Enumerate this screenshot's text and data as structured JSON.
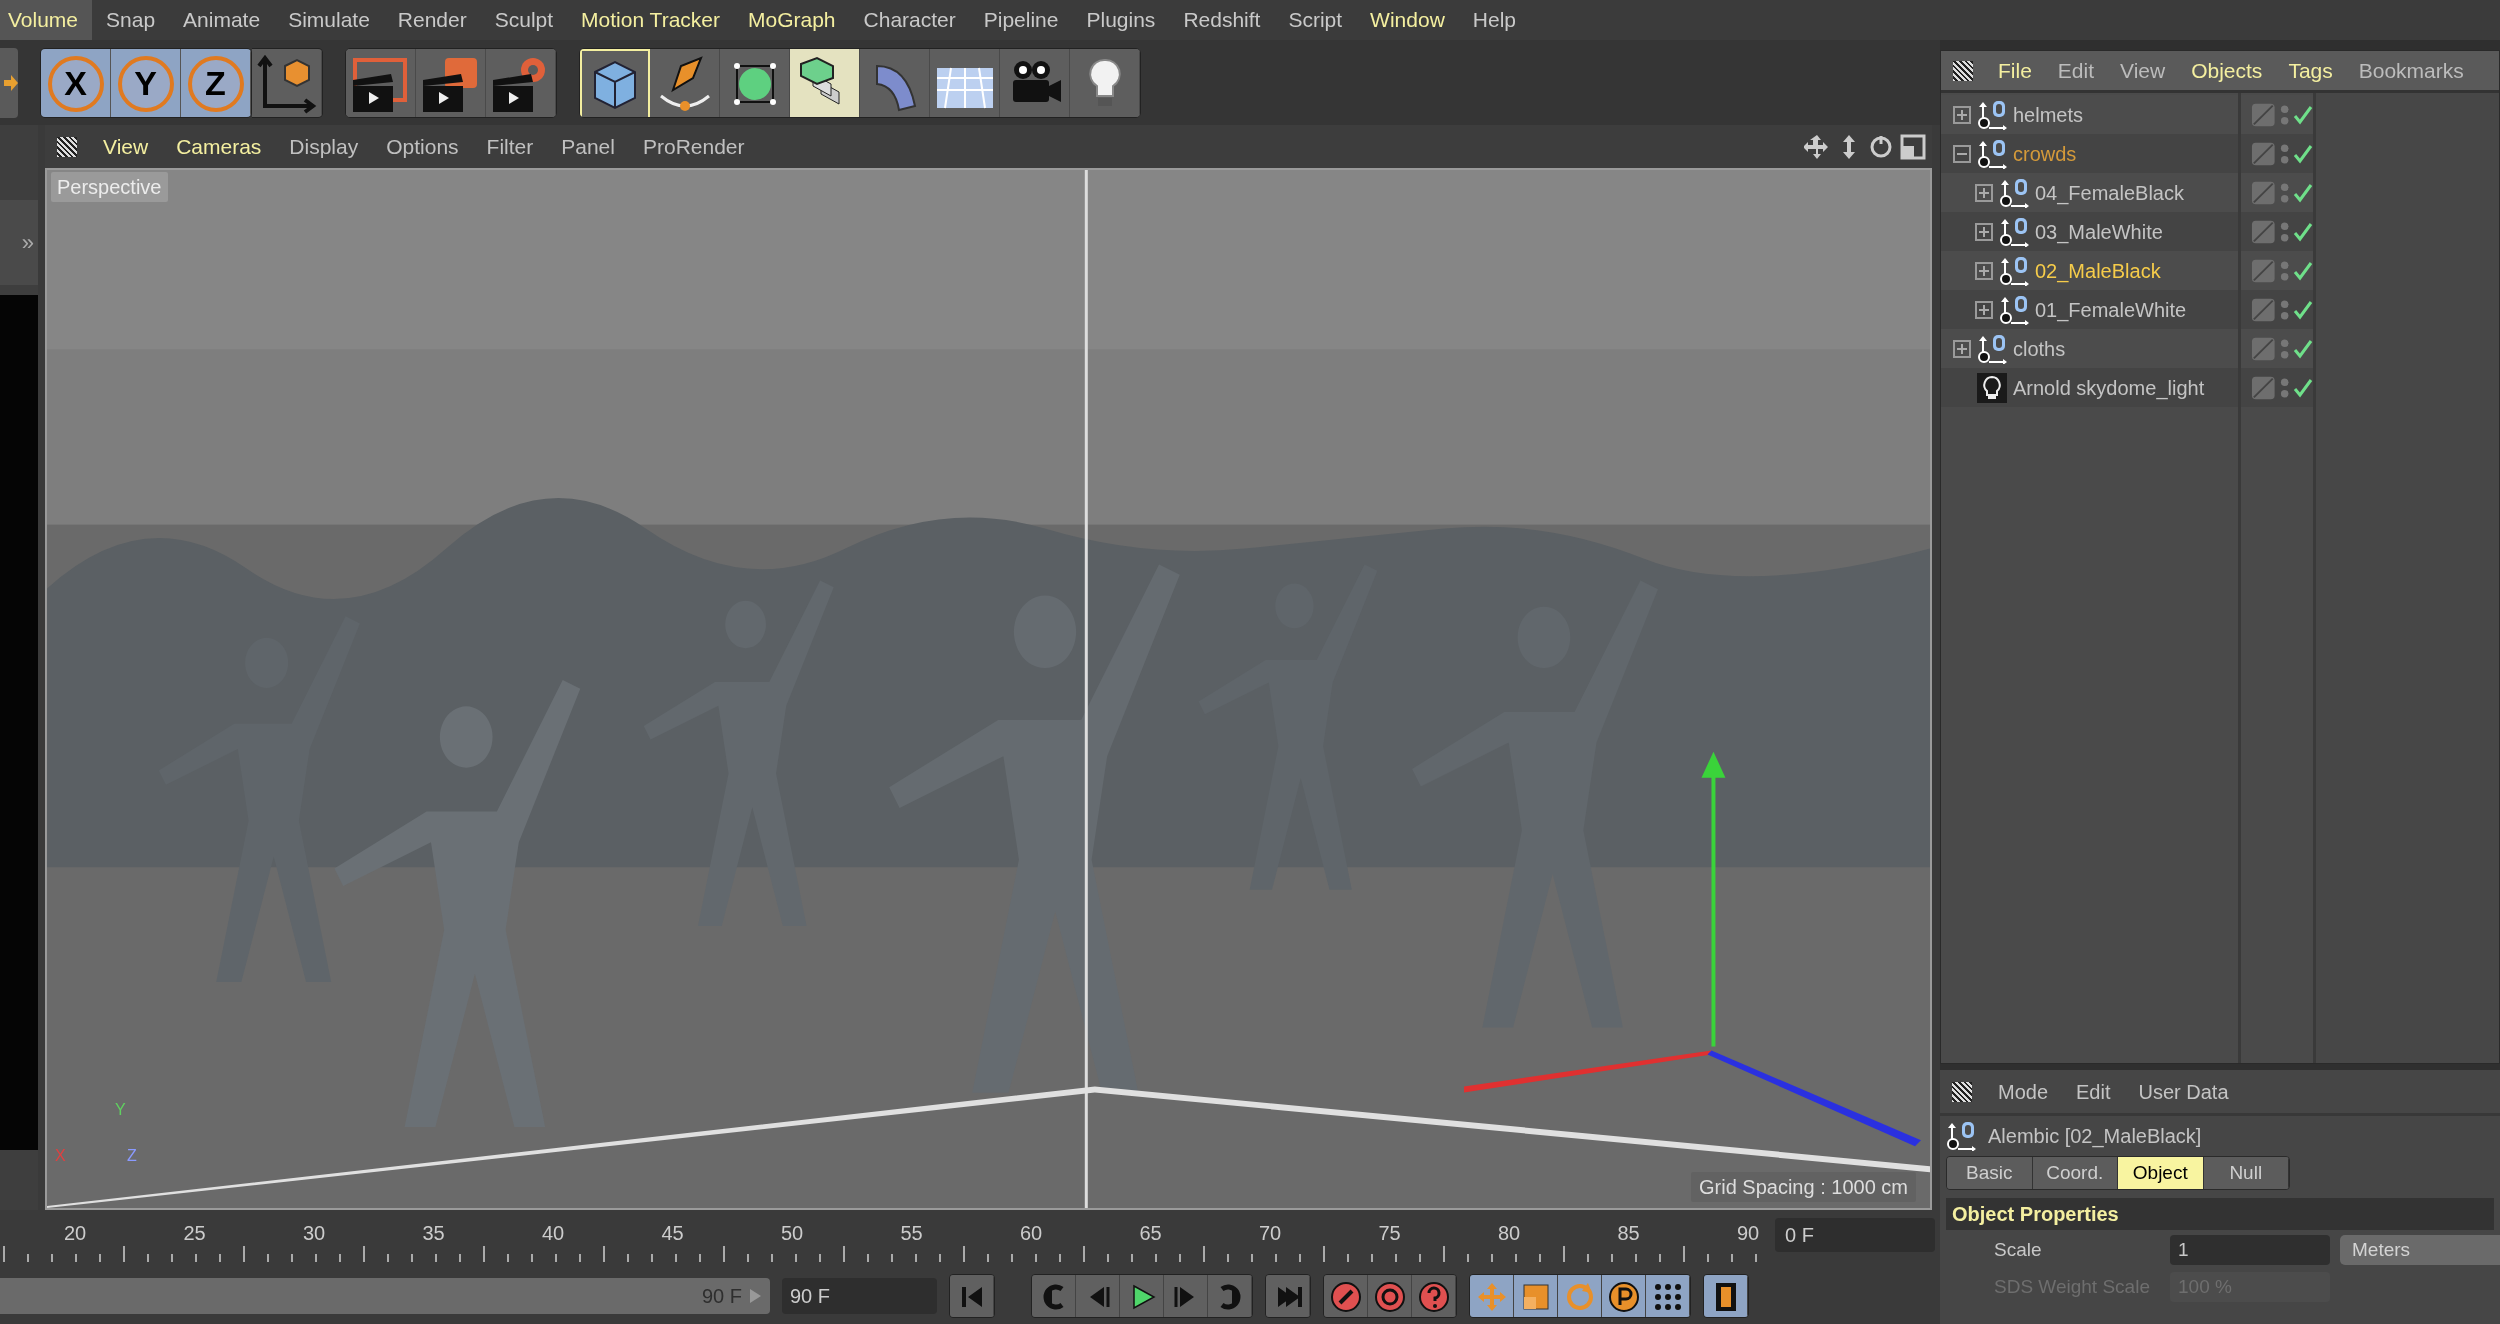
{
  "menu_bar": [
    {
      "label": "Volume",
      "selected": true,
      "accent": true
    },
    {
      "label": "Snap",
      "selected": false,
      "accent": false
    },
    {
      "label": "Animate",
      "selected": false,
      "accent": false
    },
    {
      "label": "Simulate",
      "selected": false,
      "accent": false
    },
    {
      "label": "Render",
      "selected": false,
      "accent": false
    },
    {
      "label": "Sculpt",
      "selected": false,
      "accent": false
    },
    {
      "label": "Motion Tracker",
      "selected": false,
      "accent": true
    },
    {
      "label": "MoGraph",
      "selected": false,
      "accent": true
    },
    {
      "label": "Character",
      "selected": false,
      "accent": false
    },
    {
      "label": "Pipeline",
      "selected": false,
      "accent": false
    },
    {
      "label": "Plugins",
      "selected": false,
      "accent": false
    },
    {
      "label": "Redshift",
      "selected": false,
      "accent": false
    },
    {
      "label": "Script",
      "selected": false,
      "accent": false
    },
    {
      "label": "Window",
      "selected": false,
      "accent": true
    },
    {
      "label": "Help",
      "selected": false,
      "accent": false
    }
  ],
  "toolbar": {
    "axis_locks": [
      {
        "label": "X",
        "selected": true
      },
      {
        "label": "Y",
        "selected": true
      },
      {
        "label": "Z",
        "selected": true
      }
    ],
    "tools": [
      {
        "kind": "coordinates",
        "focused": false,
        "selected": false
      },
      {
        "kind": "render_view",
        "focused": false,
        "selected": false
      },
      {
        "kind": "render_picture",
        "focused": false,
        "selected": false
      },
      {
        "kind": "render_settings",
        "focused": false,
        "selected": false
      },
      {
        "kind": "cube",
        "focused": true,
        "selected": false
      },
      {
        "kind": "pen",
        "focused": false,
        "selected": false
      },
      {
        "kind": "subdivision",
        "focused": false,
        "selected": false
      },
      {
        "kind": "cloner",
        "focused": false,
        "selected": true
      },
      {
        "kind": "deformer",
        "focused": false,
        "selected": false
      },
      {
        "kind": "floor",
        "focused": false,
        "selected": false
      },
      {
        "kind": "camera",
        "focused": false,
        "selected": false
      },
      {
        "kind": "light",
        "focused": false,
        "selected": false
      }
    ]
  },
  "left_strip": {
    "expand": "»"
  },
  "viewport": {
    "menu": [
      {
        "label": "View",
        "accent": true
      },
      {
        "label": "Cameras",
        "accent": true
      },
      {
        "label": "Display",
        "accent": false
      },
      {
        "label": "Options",
        "accent": false
      },
      {
        "label": "Filter",
        "accent": false
      },
      {
        "label": "Panel",
        "accent": false
      },
      {
        "label": "ProRender",
        "accent": false
      }
    ],
    "camera_label": "Perspective",
    "grid_spacing": "Grid Spacing : 1000 cm",
    "axis_labels": [
      "Y",
      "X",
      "Z"
    ]
  },
  "object_manager": {
    "menu": [
      {
        "label": "File",
        "accent": true
      },
      {
        "label": "Edit",
        "accent": false
      },
      {
        "label": "View",
        "accent": false
      },
      {
        "label": "Objects",
        "accent": true
      },
      {
        "label": "Tags",
        "accent": true
      },
      {
        "label": "Bookmarks",
        "accent": false
      }
    ],
    "tree": [
      {
        "name": "helmets",
        "kind": "alembic",
        "expanded": false,
        "selected": false,
        "active": false,
        "enabled": true
      },
      {
        "name": "crowds",
        "kind": "alembic",
        "expanded": true,
        "selected": true,
        "active": false,
        "enabled": true,
        "children": [
          {
            "name": "04_FemaleBlack",
            "kind": "alembic",
            "expanded": false,
            "selected": false,
            "active": false,
            "enabled": true
          },
          {
            "name": "03_MaleWhite",
            "kind": "alembic",
            "expanded": false,
            "selected": false,
            "active": false,
            "enabled": true
          },
          {
            "name": "02_MaleBlack",
            "kind": "alembic",
            "expanded": false,
            "selected": false,
            "active": true,
            "enabled": true
          },
          {
            "name": "01_FemaleWhite",
            "kind": "alembic",
            "expanded": false,
            "selected": false,
            "active": false,
            "enabled": true
          }
        ]
      },
      {
        "name": "cloths",
        "kind": "alembic",
        "expanded": false,
        "selected": false,
        "active": false,
        "enabled": true
      },
      {
        "name": "Arnold skydome_light",
        "kind": "light",
        "selected": false,
        "active": false,
        "enabled": true
      }
    ]
  },
  "attributes": {
    "menu": [
      "Mode",
      "Edit",
      "User Data"
    ],
    "title": "Alembic [02_MaleBlack]",
    "tabs": [
      {
        "label": "Basic",
        "selected": false
      },
      {
        "label": "Coord.",
        "selected": false
      },
      {
        "label": "Object",
        "selected": true
      },
      {
        "label": "Null",
        "selected": false
      }
    ],
    "section": "Object Properties",
    "fields": [
      {
        "label": "Scale",
        "value": "1",
        "unit": "Meters",
        "disabled": false
      },
      {
        "label": "SDS Weight Scale",
        "value": "100 %",
        "disabled": true
      }
    ]
  },
  "timeline": {
    "ticks": [
      "20",
      "25",
      "30",
      "35",
      "40",
      "45",
      "50",
      "55",
      "60",
      "65",
      "70",
      "75",
      "80",
      "85",
      "90"
    ],
    "current_frame": "0 F",
    "preview_end": "90 F",
    "preview_slider": {
      "level": 1
    },
    "end_frame": "90 F"
  },
  "transport": [
    {
      "kind": "first",
      "selected": false
    },
    {
      "kind": "prev_key",
      "selected": false
    },
    {
      "kind": "prev_frame",
      "selected": false
    },
    {
      "kind": "play",
      "selected": false
    },
    {
      "kind": "next_frame",
      "selected": false
    },
    {
      "kind": "next_key",
      "selected": false
    },
    {
      "kind": "last",
      "selected": false
    },
    {
      "kind": "record",
      "selected": false
    },
    {
      "kind": "autokey",
      "selected": false
    },
    {
      "kind": "key_help",
      "selected": false
    },
    {
      "kind": "move",
      "selected": true
    },
    {
      "kind": "scale",
      "selected": true
    },
    {
      "kind": "rotate",
      "selected": true
    },
    {
      "kind": "param",
      "selected": true
    },
    {
      "kind": "points",
      "selected": true
    },
    {
      "kind": "timeline",
      "selected": true
    }
  ]
}
